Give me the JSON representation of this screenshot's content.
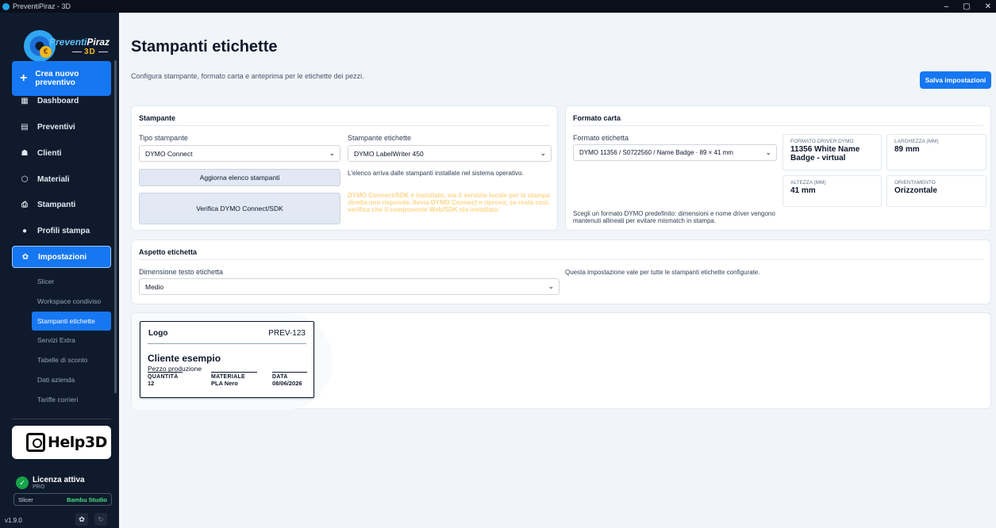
{
  "window": {
    "title": "PreventiPiraz - 3D",
    "controls": [
      "–",
      "▢",
      "✕"
    ]
  },
  "brand": {
    "name_part1": "Preventi",
    "name_part2": "Piraz",
    "suffix": "3D",
    "coin": "€"
  },
  "sidebar": {
    "create_label": "Crea nuovo preventivo",
    "items": [
      {
        "label": "Dashboard",
        "icon": "dashboard-icon"
      },
      {
        "label": "Preventivi",
        "icon": "document-icon"
      },
      {
        "label": "Clienti",
        "icon": "users-icon"
      },
      {
        "label": "Materiali",
        "icon": "cube-icon"
      },
      {
        "label": "Stampanti",
        "icon": "printer-icon"
      },
      {
        "label": "Profili stampa",
        "icon": "user-icon"
      },
      {
        "label": "Impostazioni",
        "icon": "gear-icon"
      }
    ],
    "submenu": [
      "Slicer",
      "Workspace condiviso",
      "Stampanti etichette",
      "Servizi Extra",
      "Tabelle di sconto",
      "Dati azienda",
      "Tariffe corrieri"
    ],
    "help_label": "Help3D",
    "license": {
      "title": "Licenza attiva",
      "tier": "PRO"
    },
    "slicer": {
      "key": "Slicer",
      "value": "Bambu Studio"
    },
    "version": "v1.9.0"
  },
  "page": {
    "title": "Stampanti etichette",
    "subtitle": "Configura stampante, formato carta e anteprima per le etichette dei pezzi.",
    "save_label": "Salva impostazioni"
  },
  "printer_card": {
    "title": "Stampante",
    "type_label": "Tipo stampante",
    "type_value": "DYMO Connect",
    "label_printer_label": "Stampante etichette",
    "label_printer_value": "DYMO LabelWriter 450",
    "refresh_label": "Aggiorna elenco stampanti",
    "refresh_note": "L'elenco arriva dalle stampanti installate nel sistema operativo.",
    "verify_label": "Verifica DYMO Connect/SDK",
    "verify_warning": "DYMO Connect/SDK è installato, ma il servizio locale per la stampa diretta non risponde. Avvia DYMO Connect e riprova; se resta così, verifica che il componente Web/SDK sia installato."
  },
  "paper_card": {
    "title": "Formato carta",
    "format_label": "Formato etichetta",
    "format_value": "DYMO 11356 / S0722560 / Name Badge · 89 × 41 mm",
    "note": "Scegli un formato DYMO predefinito: dimensioni e nome driver vengono mantenuti allineati per evitare mismatch in stampa.",
    "driver_key": "Formato driver DYMO",
    "driver_value": "11356 White Name Badge - virtual",
    "width_key": "Larghezza (mm)",
    "width_value": "89 mm",
    "height_key": "Altezza (mm)",
    "height_value": "41 mm",
    "orient_key": "Orientamento",
    "orient_value": "Orizzontale"
  },
  "appearance_card": {
    "title": "Aspetto etichetta",
    "size_label": "Dimensione testo etichetta",
    "size_value": "Medio",
    "note": "Questa impostazione vale per tutte le stampanti etichette configurate."
  },
  "preview": {
    "logo": "Logo",
    "code": "PREV-123",
    "client": "Cliente esempio",
    "piece": "Pezzo produzione",
    "qty_key": "QUANTITÀ",
    "qty_value": "12",
    "mat_key": "MATERIALE",
    "mat_value": "PLA Nero",
    "date_key": "DATA",
    "date_value": "08/06/2026"
  }
}
